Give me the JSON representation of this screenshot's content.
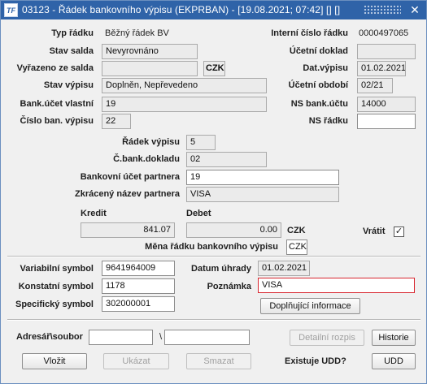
{
  "titlebar": {
    "app_icon": "TF",
    "title": "03123 - Řádek bankovního výpisu (EKPRBAN) - [19.08.2021; 07:42]  [] []"
  },
  "header": {
    "typ_radku": {
      "label": "Typ řádku",
      "value": "Běžný řádek BV"
    },
    "stav_salda": {
      "label": "Stav salda",
      "value": "Nevyrovnáno"
    },
    "vyrazeno_ze_salda": {
      "label": "Vyřazeno ze salda",
      "value": "",
      "currency": "CZK"
    },
    "stav_vypisu": {
      "label": "Stav výpisu",
      "value": "Doplněn, Nepřevedeno"
    },
    "bank_ucet_vlastni": {
      "label": "Bank.účet vlastní",
      "value": "19"
    },
    "cislo_ban_vypisu": {
      "label": "Číslo ban. výpisu",
      "value": "22"
    },
    "interni_cislo_radku": {
      "label": "Interní číslo řádku",
      "value": "0000497065"
    },
    "ucetni_doklad": {
      "label": "Účetní doklad",
      "value": ""
    },
    "dat_vypisu": {
      "label": "Dat.výpisu",
      "value": "01.02.2021"
    },
    "ucetni_obdobi": {
      "label": "Účetní období",
      "value": "02/21"
    },
    "ns_bank_uctu": {
      "label": "NS bank.účtu",
      "value": "14000"
    },
    "ns_radku": {
      "label": "NS řádku",
      "value": ""
    }
  },
  "mid": {
    "radek_vypisu": {
      "label": "Řádek výpisu",
      "value": "5"
    },
    "c_bank_dokladu": {
      "label": "Č.bank.dokladu",
      "value": "02"
    },
    "bankovni_ucet_partnera": {
      "label": "Bankovní účet partnera",
      "value": "19"
    },
    "zkraceny_nazev_partnera": {
      "label": "Zkrácený název partnera",
      "value": "VISA"
    },
    "kredit": {
      "label": "Kredit",
      "value": "841.07"
    },
    "debet": {
      "label": "Debet",
      "value": "0.00"
    },
    "currency": "CZK",
    "vratit": {
      "label": "Vrátit",
      "checked": "✓"
    },
    "mena_radku": {
      "label": "Měna řádku bankovního výpisu",
      "value": "CZK"
    }
  },
  "symbols": {
    "variabilni": {
      "label": "Variabilní symbol",
      "value": "9641964009"
    },
    "konstatni": {
      "label": "Konstatní symbol",
      "value": "1178"
    },
    "specificky": {
      "label": "Specifický symbol",
      "value": "302000001"
    },
    "datum_uhrady": {
      "label": "Datum úhrady",
      "value": "01.02.2021"
    },
    "poznamka": {
      "label": "Poznámka",
      "value": "VISA"
    },
    "doplnujici_btn": "Doplňující informace"
  },
  "footer": {
    "adresar_label": "Adresář\\soubor",
    "adresar_value": "",
    "backslash": "\\",
    "soubor_value": "",
    "detailni_rozpis": "Detailní rozpis",
    "historie": "Historie",
    "vlozit": "Vložit",
    "ukazat": "Ukázat",
    "smazat": "Smazat",
    "existuje_udd": "Existuje UDD?",
    "udd": "UDD"
  }
}
